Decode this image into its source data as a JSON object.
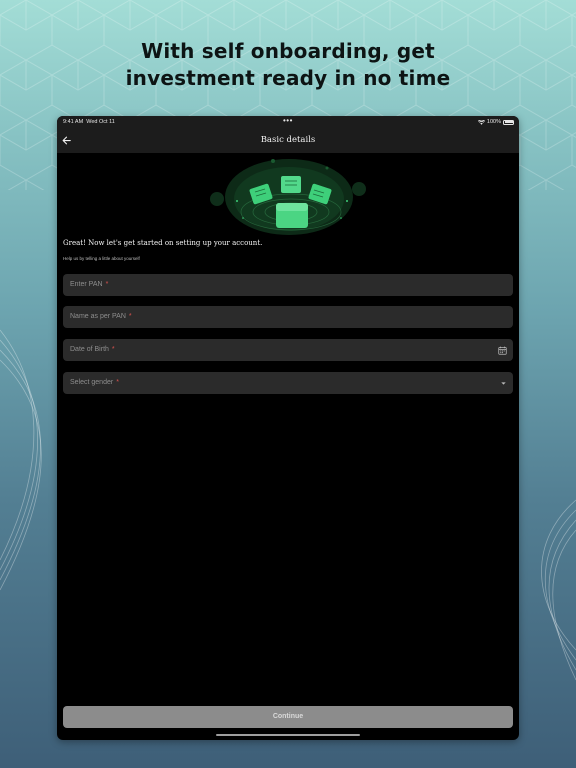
{
  "headline": {
    "line1": "With self onboarding, get",
    "line2": "investment ready in no time"
  },
  "status_bar": {
    "time": "9:41 AM",
    "date": "Wed Oct 11",
    "dots": "•••",
    "battery": "100%"
  },
  "nav": {
    "title": "Basic details",
    "back_icon": "arrow-left-icon"
  },
  "intro": {
    "title": "Great! Now let's get started on setting up your account.",
    "subtitle": "Help us by telling a little about yourself"
  },
  "form": {
    "pan_placeholder": "Enter PAN",
    "name_placeholder": "Name as per PAN",
    "dob_placeholder": "Date of Birth",
    "gender_placeholder": "Select gender",
    "required_mark": "*",
    "dob_icon": "calendar-icon",
    "gender_icon": "caret-down-icon"
  },
  "footer": {
    "continue_label": "Continue"
  },
  "colors": {
    "accent": "#3ecf7a",
    "required": "#d9534f",
    "field_bg": "#2b2b2b",
    "button_bg": "#8c8c8c"
  }
}
